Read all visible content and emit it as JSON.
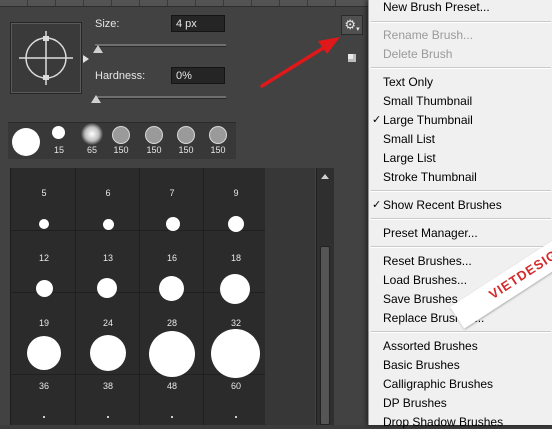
{
  "panel": {
    "size_label": "Size:",
    "size_value": "4 px",
    "hardness_label": "Hardness:",
    "hardness_value": "0%",
    "size_slider_level": 0.02,
    "hardness_slider_level": 0.0
  },
  "recent_brushes": [
    {
      "label": ""
    },
    {
      "label": "15"
    },
    {
      "label": "65"
    },
    {
      "label": "150"
    },
    {
      "label": "150"
    },
    {
      "label": "150"
    },
    {
      "label": "150"
    }
  ],
  "brush_grid": {
    "rows": [
      [
        "5",
        "6",
        "7",
        "9"
      ],
      [
        "12",
        "13",
        "16",
        "18"
      ],
      [
        "19",
        "24",
        "28",
        "32"
      ],
      [
        "36",
        "38",
        "48",
        "60"
      ]
    ]
  },
  "menu": {
    "new_brush_preset": "New Brush Preset...",
    "rename_brush": "Rename Brush...",
    "delete_brush": "Delete Brush",
    "text_only": "Text Only",
    "small_thumbnail": "Small Thumbnail",
    "large_thumbnail": "Large Thumbnail",
    "small_list": "Small List",
    "large_list": "Large List",
    "stroke_thumbnail": "Stroke Thumbnail",
    "show_recent_brushes": "Show Recent Brushes",
    "preset_manager": "Preset Manager...",
    "reset_brushes": "Reset Brushes...",
    "load_brushes": "Load Brushes...",
    "save_brushes": "Save Brushes...",
    "replace_brushes": "Replace Brushes...",
    "assorted_brushes": "Assorted Brushes",
    "basic_brushes": "Basic Brushes",
    "calligraphic_brushes": "Calligraphic Brushes",
    "dp_brushes": "DP Brushes",
    "drop_shadow_brushes": "Drop Shadow Brushes",
    "checkmark": "✓"
  },
  "watermark": "VIETDESIGNER.NET",
  "colors": {
    "arrow": "#e0181a",
    "panel_bg": "#424242",
    "menu_bg": "#f0f0f0",
    "watermark_text": "#d42a2a"
  },
  "icons": {
    "gear": "gear-icon",
    "new_preset": "new-preset-icon",
    "flyout": "flyout-triangle-icon"
  }
}
